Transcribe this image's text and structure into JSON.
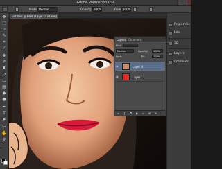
{
  "app": {
    "title": "Adobe Photoshop CS6"
  },
  "options_bar": {
    "mode_label": "Mode:",
    "mode_value": "Normal",
    "opacity_label": "Opacity:",
    "opacity_value": "100%",
    "flow_label": "Flow:",
    "flow_value": "100%"
  },
  "document": {
    "tab_label": "untitled @ 66% (Layer 0, RGB/8)"
  },
  "layers_panel": {
    "tabs": [
      "Layers",
      "Channels"
    ],
    "kind_label": "Kind",
    "blend_mode": "Normal",
    "opacity_label": "Opacity:",
    "opacity_value": "100%",
    "lock_label": "Lock:",
    "fill_label": "Fill:",
    "fill_value": "100%",
    "layers": [
      {
        "name": "Layer 0",
        "selected": true,
        "thumb_color": "#c98a6a"
      },
      {
        "name": "Layer 1",
        "selected": false,
        "thumb_color": "#e8281f"
      }
    ]
  },
  "dock": {
    "items": [
      {
        "label": "Properties",
        "icon": "properties-icon"
      },
      {
        "label": "Info",
        "icon": "info-icon"
      },
      {
        "label": "3D",
        "icon": "3d-icon"
      },
      {
        "label": "Layers",
        "icon": "layers-icon"
      },
      {
        "label": "Channels",
        "icon": "channels-icon"
      }
    ]
  },
  "colors": {
    "foreground": "#111111",
    "background": "#ffffff",
    "selection": "#5b6e8c",
    "fill_red": "#e8281f"
  }
}
